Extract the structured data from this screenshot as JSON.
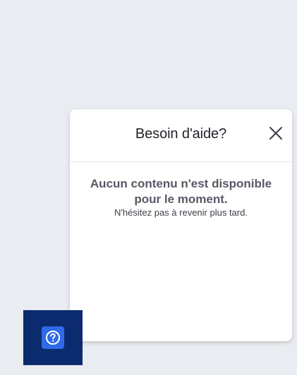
{
  "help_panel": {
    "title": "Besoin d'aide?",
    "close_icon": "close-icon",
    "empty_state": {
      "title": "Aucun contenu n'est disponible pour le moment.",
      "subtitle": "N'hésitez pas à revenir plus tard."
    }
  },
  "launcher": {
    "icon": "question-circle-icon",
    "background_color": "#0c2b6e",
    "icon_background_color": "#2f6ae8"
  },
  "colors": {
    "page_background": "#e9ecf0",
    "panel_background": "#ffffff"
  }
}
